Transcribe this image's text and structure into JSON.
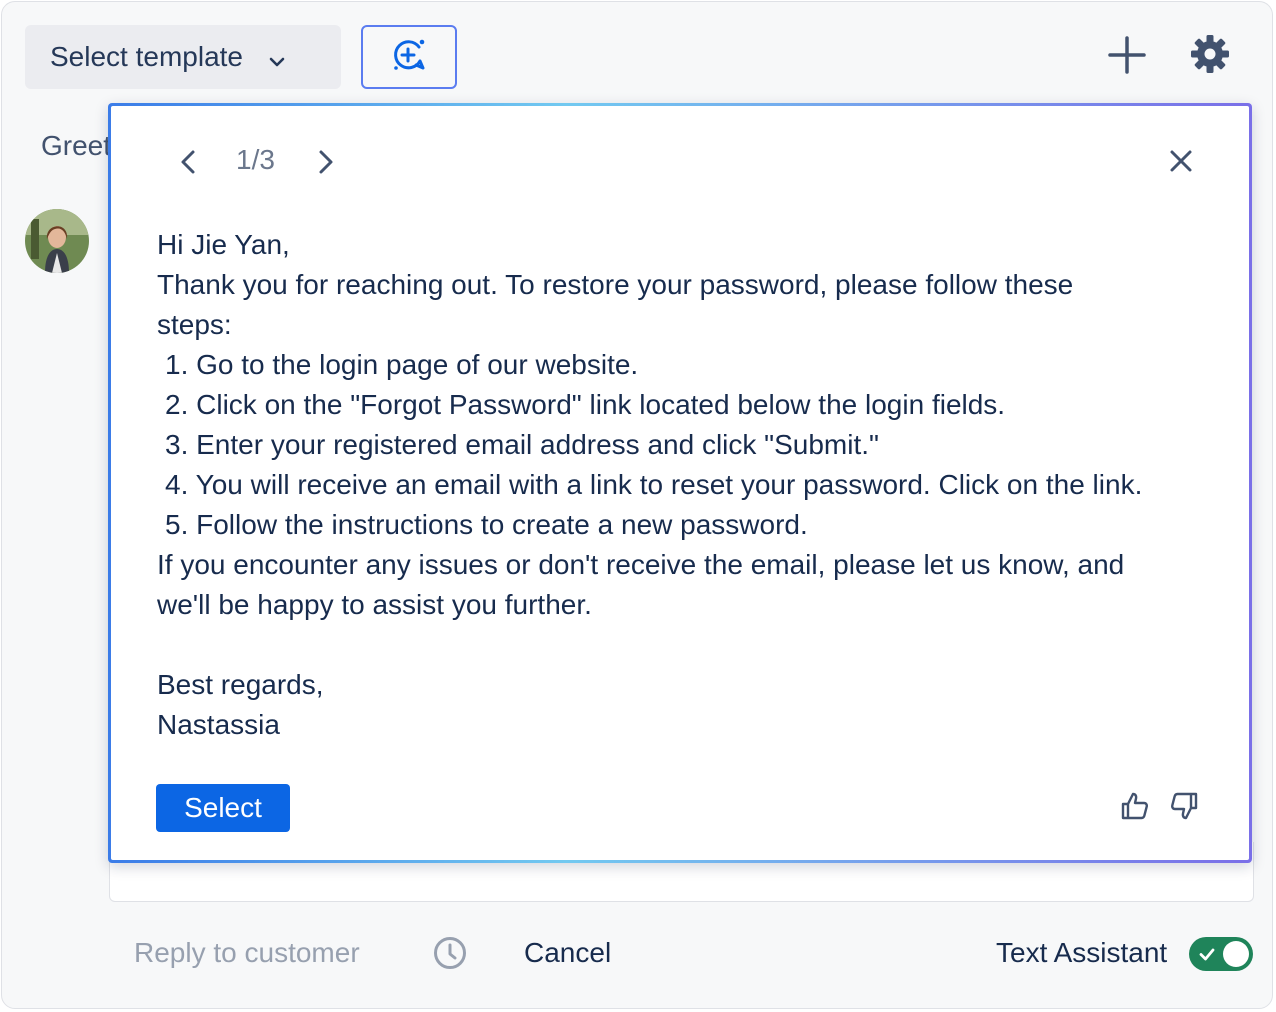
{
  "toolbar": {
    "template_label": "Select template",
    "icons": [
      "chevron-down-icon",
      "ai-sparkle-icon",
      "plus-icon",
      "gear-icon"
    ]
  },
  "background": {
    "greeting_partial": "Greet"
  },
  "suggestion": {
    "counter": "1/3",
    "lines": [
      "Hi Jie Yan,",
      "Thank you for reaching out. To restore your password, please follow these",
      "steps:"
    ],
    "steps": [
      "1. Go to the login page of our website.",
      "2. Click on the \"Forgot Password\" link located below the login fields.",
      "3. Enter your registered email address and click \"Submit.\"",
      "4. You will receive an email with a link to reset your password. Click on the link.",
      "5. Follow the instructions to create a new password."
    ],
    "closing_lines": [
      "If you encounter any issues or don't receive the email, please let us know, and",
      "we'll be happy to assist you further."
    ],
    "signoff": "Best regards,",
    "signature": "Nastassia",
    "select_label": "Select"
  },
  "footer": {
    "reply_label": "Reply to customer",
    "cancel_label": "Cancel",
    "assistant_label": "Text Assistant",
    "assistant_enabled": true
  },
  "colors": {
    "primary": "#0c66e4",
    "toggle_on": "#1f845a",
    "ai_border": "#5b7cf0"
  }
}
